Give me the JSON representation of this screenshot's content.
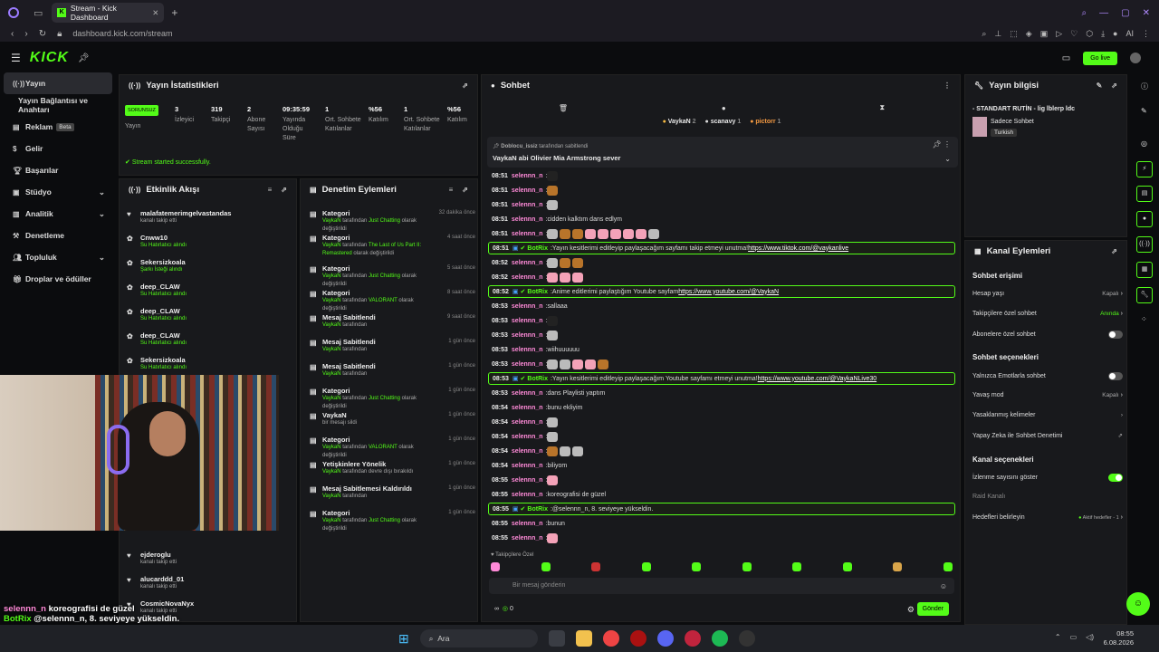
{
  "browser": {
    "tab_title": "Stream - Kick Dashboard",
    "url": "dashboard.kick.com/stream",
    "ai_label": "AI"
  },
  "header": {
    "logo": "KICK",
    "go_live": "Go live"
  },
  "sidebar": {
    "items": [
      {
        "label": "Yayın",
        "active": true
      },
      {
        "label": "Yayın Bağlantısı ve Anahtarı"
      },
      {
        "label": "Reklam",
        "badge": "Beta"
      },
      {
        "label": "Gelir"
      },
      {
        "label": "Başarılar"
      },
      {
        "label": "Stüdyo",
        "chevron": true
      },
      {
        "label": "Analitik",
        "chevron": true
      },
      {
        "label": "Denetleme"
      },
      {
        "label": "Topluluk",
        "chevron": true
      },
      {
        "label": "Droplar ve ödüller"
      }
    ]
  },
  "stats": {
    "title": "Yayın İstatistikleri",
    "status_badge": "SORUNSUZ",
    "status_label": "Yayın",
    "items": [
      {
        "value": "3",
        "label": "İzleyici"
      },
      {
        "value": "319",
        "label": "Takipçi"
      },
      {
        "value": "2",
        "label": "Abone Sayısı"
      },
      {
        "value": "09:35:59",
        "label": "Yayında Olduğu Süre"
      },
      {
        "value": "1",
        "label": "Ort. Sohbete Katılanlar"
      },
      {
        "value": "%56",
        "label": "Katılım"
      },
      {
        "value": "1",
        "label": "Ort. Sohbete Katılanlar"
      },
      {
        "value": "%56",
        "label": "Katılım"
      }
    ],
    "success_message": "Stream started successfully."
  },
  "activity": {
    "title": "Etkinlik Akışı",
    "items": [
      {
        "user": "malafatemerimgelvastandas",
        "desc": "kanalı takip etti",
        "time": "14 dakika önce",
        "green": false
      },
      {
        "user": "Cnww10",
        "desc": "Su Hatırlatıcı alındı",
        "time": "4 saat önce",
        "green": true
      },
      {
        "user": "Sekersizkoala",
        "desc": "Şarkı İsteği alındı",
        "time": "5 saat önce",
        "green": true
      },
      {
        "user": "deep_CLAW",
        "desc": "Su Hatırlatıcı alındı",
        "time": "6 saat önce",
        "green": true
      },
      {
        "user": "deep_CLAW",
        "desc": "Su Hatırlatıcı alındı",
        "time": "6 saat önce",
        "green": true
      },
      {
        "user": "deep_CLAW",
        "desc": "Su Hatırlatıcı alındı",
        "time": "6 saat önce",
        "green": true
      },
      {
        "user": "Sekersizkoala",
        "desc": "Su Hatırlatıcı alındı",
        "time": "7 saat önce",
        "green": true
      },
      {
        "user": "ejderoglu",
        "desc": "kanalı takip etti",
        "time": "1 gün önce",
        "green": false
      },
      {
        "user": "alucarddd_01",
        "desc": "kanalı takip etti",
        "time": "1 gün önce",
        "green": false
      },
      {
        "user": "CosmicNovaNyx",
        "desc": "kanalı takip etti",
        "time": "1 gün önce",
        "green": false
      }
    ]
  },
  "moderation": {
    "title": "Denetim Eylemleri",
    "items": [
      {
        "title": "Kategori",
        "who": "VaykaN",
        "mid": " tarafından ",
        "what": "Just Chatting",
        "tail": " olarak değiştirildi",
        "time": "32 dakika önce"
      },
      {
        "title": "Kategori",
        "who": "VaykaN",
        "mid": " tarafından ",
        "what": "The Last of Us Part II: Remastered",
        "tail": " olarak değiştirildi",
        "time": "4 saat önce"
      },
      {
        "title": "Kategori",
        "who": "VaykaN",
        "mid": " tarafından ",
        "what": "Just Chatting",
        "tail": " olarak değiştirildi",
        "time": "5 saat önce"
      },
      {
        "title": "Kategori",
        "who": "VaykaN",
        "mid": " tarafından ",
        "what": "VALORANT",
        "tail": " olarak değiştirildi",
        "time": "8 saat önce"
      },
      {
        "title": "Mesaj Sabitlendi",
        "who": "VaykaN",
        "mid": " tarafından",
        "what": "",
        "tail": "",
        "time": "9 saat önce"
      },
      {
        "title": "Mesaj Sabitlendi",
        "who": "VaykaN",
        "mid": " tarafından",
        "what": "",
        "tail": "",
        "time": "1 gün önce"
      },
      {
        "title": "Mesaj Sabitlendi",
        "who": "VaykaN",
        "mid": " tarafından",
        "what": "",
        "tail": "",
        "time": "1 gün önce"
      },
      {
        "title": "Kategori",
        "who": "VaykaN",
        "mid": " tarafından ",
        "what": "Just Chatting",
        "tail": " olarak değiştirildi",
        "time": "1 gün önce"
      },
      {
        "title": "VaykaN",
        "who": "",
        "mid": "bir mesajı sildi",
        "what": "",
        "tail": "",
        "time": "1 gün önce"
      },
      {
        "title": "Kategori",
        "who": "VaykaN",
        "mid": " tarafından ",
        "what": "VALORANT",
        "tail": " olarak değiştirildi",
        "time": "1 gün önce"
      },
      {
        "title": "Yetişkinlere Yönelik",
        "who": "VaykaN",
        "mid": " tarafından devre dışı bırakıldı",
        "what": "",
        "tail": "",
        "time": "1 gün önce"
      },
      {
        "title": "Mesaj Sabitlemesi Kaldırıldı",
        "who": "VaykaN",
        "mid": " tarafından",
        "what": "",
        "tail": "",
        "time": "1 gün önce"
      },
      {
        "title": "Kategori",
        "who": "VaykaN",
        "mid": " tarafından ",
        "what": "Just Chatting",
        "tail": " olarak değiştirildi",
        "time": "1 gün önce"
      }
    ]
  },
  "chat": {
    "title": "Sohbet",
    "top_users": [
      {
        "name": "VaykaN",
        "count": "2",
        "color": "#f5b942"
      },
      {
        "name": "scanavy",
        "count": "1",
        "color": "#dddddd"
      },
      {
        "name": "pictorr",
        "count": "1",
        "color": "#f59a42"
      }
    ],
    "pinned_by_user": "Doblocu_issiz",
    "pinned_by_suffix": " tarafından sabitlendi",
    "pinned_message": "VaykaN abi Olivier Mia Armstrong sever",
    "messages": [
      {
        "time": "08:51",
        "user": "selennn_n",
        "text": "",
        "emotes": [
          "dk"
        ]
      },
      {
        "time": "08:51",
        "user": "selennn_n",
        "text": "",
        "emotes": [
          "br"
        ]
      },
      {
        "time": "08:51",
        "user": "selennn_n",
        "text": "",
        "emotes": [
          "gr"
        ]
      },
      {
        "time": "08:51",
        "user": "selennn_n",
        "text": "cidden kalktım dans edlym",
        "emotes": []
      },
      {
        "time": "08:51",
        "user": "selennn_n",
        "text": "",
        "emotes": [
          "gr",
          "br",
          "br",
          "p",
          "p",
          "p",
          "p",
          "p",
          "gr"
        ]
      },
      {
        "time": "08:51",
        "user": "BotRix",
        "bot": true,
        "text": "Yayın kesitlerimi editleyip paylaşacağım sayfamı takip etmeyi unutma! ",
        "link": "https://www.tiktok.com/@vaykanlive"
      },
      {
        "time": "08:52",
        "user": "selennn_n",
        "text": "",
        "emotes": [
          "gr",
          "br",
          "br"
        ]
      },
      {
        "time": "08:52",
        "user": "selennn_n",
        "text": "",
        "emotes": [
          "p",
          "p",
          "p"
        ]
      },
      {
        "time": "08:52",
        "user": "BotRix",
        "bot": true,
        "text": "Anime editlerimi paylaştığım Youtube sayfam ",
        "link": "https://www.youtube.com/@VaykaN"
      },
      {
        "time": "08:53",
        "user": "selennn_n",
        "text": "sallaaa",
        "emotes": []
      },
      {
        "time": "08:53",
        "user": "selennn_n",
        "text": "",
        "emotes": [
          "dk"
        ]
      },
      {
        "time": "08:53",
        "user": "selennn_n",
        "text": "",
        "emotes": [
          "gr"
        ]
      },
      {
        "time": "08:53",
        "user": "selennn_n",
        "text": "wiihuuuuuu",
        "emotes": []
      },
      {
        "time": "08:53",
        "user": "selennn_n",
        "text": "",
        "emotes": [
          "gr",
          "gr",
          "p",
          "p",
          "br"
        ]
      },
      {
        "time": "08:53",
        "user": "BotRix",
        "bot": true,
        "text": "Yayın kesitlerimi editleyip paylaşacağım Youtube sayfamı etmeyi unutma! ",
        "link": "https://www.youtube.com/@VaykaNLive30"
      },
      {
        "time": "08:53",
        "user": "selennn_n",
        "text": "dans Playlisti yaptım",
        "emotes": []
      },
      {
        "time": "08:54",
        "user": "selennn_n",
        "text": "bunu ekliyim",
        "emotes": []
      },
      {
        "time": "08:54",
        "user": "selennn_n",
        "text": "",
        "emotes": [
          "gr"
        ]
      },
      {
        "time": "08:54",
        "user": "selennn_n",
        "text": "",
        "emotes": [
          "gr"
        ]
      },
      {
        "time": "08:54",
        "user": "selennn_n",
        "text": "",
        "emotes": [
          "br",
          "gr",
          "gr"
        ]
      },
      {
        "time": "08:54",
        "user": "selennn_n",
        "text": "biliyom",
        "emotes": []
      },
      {
        "time": "08:55",
        "user": "selennn_n",
        "text": "",
        "emotes": [
          "p"
        ]
      },
      {
        "time": "08:55",
        "user": "selennn_n",
        "text": "koreografisi de güzel",
        "emotes": []
      },
      {
        "time": "08:55",
        "user": "BotRix",
        "bot": true,
        "text": "@selennn_n, 8. seviyeye yükseldin.",
        "link": ""
      },
      {
        "time": "08:55",
        "user": "selennn_n",
        "text": "bunun",
        "emotes": []
      },
      {
        "time": "08:55",
        "user": "selennn_n",
        "text": "",
        "emotes": [
          "p"
        ]
      }
    ],
    "followers_label": "Takipçilere Özel",
    "input_placeholder": "Bir mesaj gönderin",
    "points": "0",
    "send_label": "Gönder"
  },
  "stream_info": {
    "title": "Yayın bilgisi",
    "stream_title": "- STANDART RUTİN - lig lblerp ldc",
    "category": "Sadece Sohbet",
    "tag": "Turkish"
  },
  "channel_actions": {
    "title": "Kanal Eylemleri",
    "chat_access_title": "Sohbet erişimi",
    "account_age": "Hesap yaşı",
    "account_age_value": "Kapalı",
    "followers_chat": "Takipçilere özel sohbet",
    "followers_chat_value": "Anında",
    "subs_chat": "Abonelere özel sohbet",
    "chat_options_title": "Sohbet seçenekleri",
    "emote_only": "Yalnızca Emotlarla sohbet",
    "slow_mode": "Yavaş mod",
    "slow_mode_value": "Kapalı",
    "banned_words": "Yasaklanmış kelimeler",
    "ai_moderation": "Yapay Zeka ile Sohbet Denetimi",
    "channel_options_title": "Kanal seçenekleri",
    "show_viewers": "İzlenme sayısını göster",
    "raid": "Raid Kanalı",
    "goals": "Hedefleri belirleyin",
    "goals_value": "Aktif hedefler - 1"
  },
  "overlay_chat": {
    "line1_user": "selennn_n",
    "line1_text": "koreografisi de güzel",
    "line2_user": "BotRix",
    "line2_text": "@selennn_n, 8. seviyeye yükseldin."
  },
  "taskbar": {
    "search": "Ara",
    "time": "08:55",
    "date": "6.08.2026"
  }
}
